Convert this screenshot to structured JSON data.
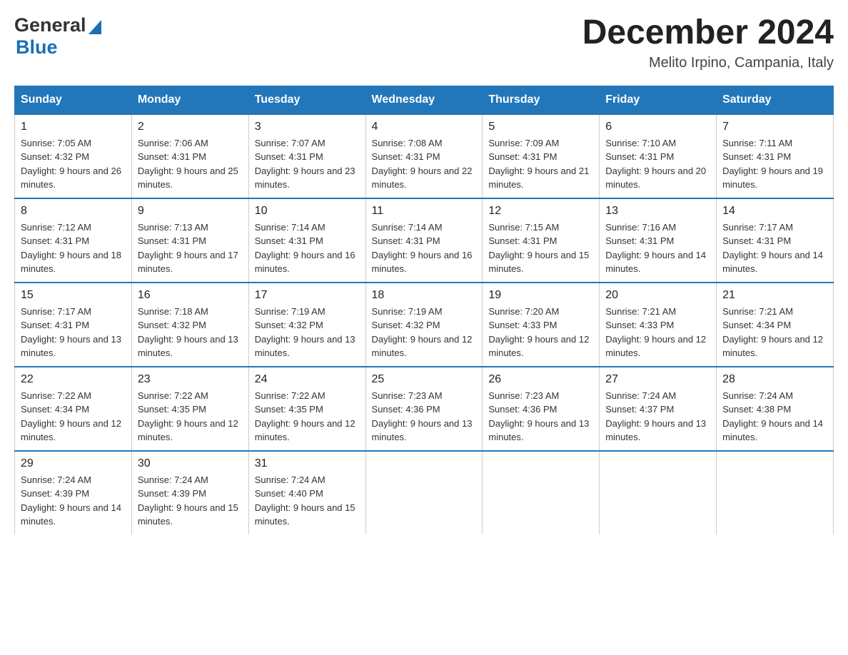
{
  "header": {
    "logo_general": "General",
    "logo_blue": "Blue",
    "month_title": "December 2024",
    "location": "Melito Irpino, Campania, Italy"
  },
  "days_of_week": [
    "Sunday",
    "Monday",
    "Tuesday",
    "Wednesday",
    "Thursday",
    "Friday",
    "Saturday"
  ],
  "weeks": [
    [
      {
        "day": "1",
        "sunrise": "7:05 AM",
        "sunset": "4:32 PM",
        "daylight": "9 hours and 26 minutes."
      },
      {
        "day": "2",
        "sunrise": "7:06 AM",
        "sunset": "4:31 PM",
        "daylight": "9 hours and 25 minutes."
      },
      {
        "day": "3",
        "sunrise": "7:07 AM",
        "sunset": "4:31 PM",
        "daylight": "9 hours and 23 minutes."
      },
      {
        "day": "4",
        "sunrise": "7:08 AM",
        "sunset": "4:31 PM",
        "daylight": "9 hours and 22 minutes."
      },
      {
        "day": "5",
        "sunrise": "7:09 AM",
        "sunset": "4:31 PM",
        "daylight": "9 hours and 21 minutes."
      },
      {
        "day": "6",
        "sunrise": "7:10 AM",
        "sunset": "4:31 PM",
        "daylight": "9 hours and 20 minutes."
      },
      {
        "day": "7",
        "sunrise": "7:11 AM",
        "sunset": "4:31 PM",
        "daylight": "9 hours and 19 minutes."
      }
    ],
    [
      {
        "day": "8",
        "sunrise": "7:12 AM",
        "sunset": "4:31 PM",
        "daylight": "9 hours and 18 minutes."
      },
      {
        "day": "9",
        "sunrise": "7:13 AM",
        "sunset": "4:31 PM",
        "daylight": "9 hours and 17 minutes."
      },
      {
        "day": "10",
        "sunrise": "7:14 AM",
        "sunset": "4:31 PM",
        "daylight": "9 hours and 16 minutes."
      },
      {
        "day": "11",
        "sunrise": "7:14 AM",
        "sunset": "4:31 PM",
        "daylight": "9 hours and 16 minutes."
      },
      {
        "day": "12",
        "sunrise": "7:15 AM",
        "sunset": "4:31 PM",
        "daylight": "9 hours and 15 minutes."
      },
      {
        "day": "13",
        "sunrise": "7:16 AM",
        "sunset": "4:31 PM",
        "daylight": "9 hours and 14 minutes."
      },
      {
        "day": "14",
        "sunrise": "7:17 AM",
        "sunset": "4:31 PM",
        "daylight": "9 hours and 14 minutes."
      }
    ],
    [
      {
        "day": "15",
        "sunrise": "7:17 AM",
        "sunset": "4:31 PM",
        "daylight": "9 hours and 13 minutes."
      },
      {
        "day": "16",
        "sunrise": "7:18 AM",
        "sunset": "4:32 PM",
        "daylight": "9 hours and 13 minutes."
      },
      {
        "day": "17",
        "sunrise": "7:19 AM",
        "sunset": "4:32 PM",
        "daylight": "9 hours and 13 minutes."
      },
      {
        "day": "18",
        "sunrise": "7:19 AM",
        "sunset": "4:32 PM",
        "daylight": "9 hours and 12 minutes."
      },
      {
        "day": "19",
        "sunrise": "7:20 AM",
        "sunset": "4:33 PM",
        "daylight": "9 hours and 12 minutes."
      },
      {
        "day": "20",
        "sunrise": "7:21 AM",
        "sunset": "4:33 PM",
        "daylight": "9 hours and 12 minutes."
      },
      {
        "day": "21",
        "sunrise": "7:21 AM",
        "sunset": "4:34 PM",
        "daylight": "9 hours and 12 minutes."
      }
    ],
    [
      {
        "day": "22",
        "sunrise": "7:22 AM",
        "sunset": "4:34 PM",
        "daylight": "9 hours and 12 minutes."
      },
      {
        "day": "23",
        "sunrise": "7:22 AM",
        "sunset": "4:35 PM",
        "daylight": "9 hours and 12 minutes."
      },
      {
        "day": "24",
        "sunrise": "7:22 AM",
        "sunset": "4:35 PM",
        "daylight": "9 hours and 12 minutes."
      },
      {
        "day": "25",
        "sunrise": "7:23 AM",
        "sunset": "4:36 PM",
        "daylight": "9 hours and 13 minutes."
      },
      {
        "day": "26",
        "sunrise": "7:23 AM",
        "sunset": "4:36 PM",
        "daylight": "9 hours and 13 minutes."
      },
      {
        "day": "27",
        "sunrise": "7:24 AM",
        "sunset": "4:37 PM",
        "daylight": "9 hours and 13 minutes."
      },
      {
        "day": "28",
        "sunrise": "7:24 AM",
        "sunset": "4:38 PM",
        "daylight": "9 hours and 14 minutes."
      }
    ],
    [
      {
        "day": "29",
        "sunrise": "7:24 AM",
        "sunset": "4:39 PM",
        "daylight": "9 hours and 14 minutes."
      },
      {
        "day": "30",
        "sunrise": "7:24 AM",
        "sunset": "4:39 PM",
        "daylight": "9 hours and 15 minutes."
      },
      {
        "day": "31",
        "sunrise": "7:24 AM",
        "sunset": "4:40 PM",
        "daylight": "9 hours and 15 minutes."
      },
      null,
      null,
      null,
      null
    ]
  ]
}
